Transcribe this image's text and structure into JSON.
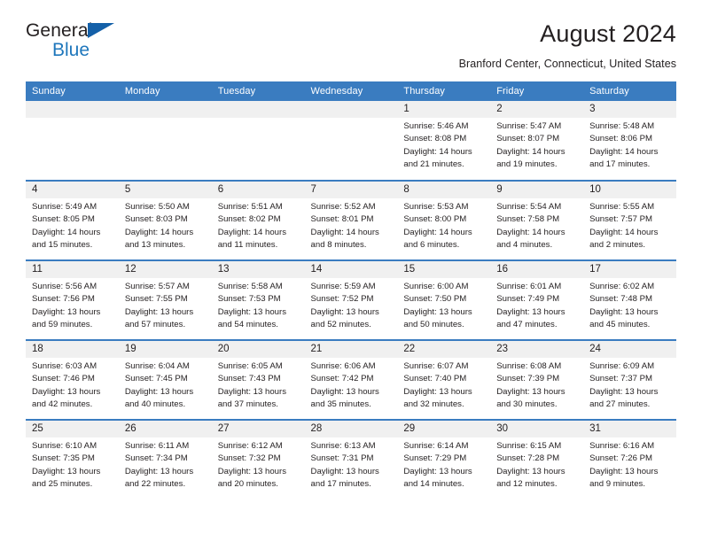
{
  "brand": {
    "name_part1": "General",
    "name_part2": "Blue",
    "flag_icon": "triangle-flag-icon",
    "accent_color": "#1f77bc"
  },
  "header": {
    "month_title": "August 2024",
    "location": "Branford Center, Connecticut, United States"
  },
  "theme": {
    "header_row_bg": "#3a7cc0",
    "daynum_bg": "#f0f0f0",
    "row_separator": "#3a7cc0"
  },
  "weekday_headers": [
    "Sunday",
    "Monday",
    "Tuesday",
    "Wednesday",
    "Thursday",
    "Friday",
    "Saturday"
  ],
  "weeks": [
    [
      {
        "day": "",
        "empty": true,
        "sunrise": "",
        "sunset": "",
        "daylight_line1": "",
        "daylight_line2": ""
      },
      {
        "day": "",
        "empty": true,
        "sunrise": "",
        "sunset": "",
        "daylight_line1": "",
        "daylight_line2": ""
      },
      {
        "day": "",
        "empty": true,
        "sunrise": "",
        "sunset": "",
        "daylight_line1": "",
        "daylight_line2": ""
      },
      {
        "day": "",
        "empty": true,
        "sunrise": "",
        "sunset": "",
        "daylight_line1": "",
        "daylight_line2": ""
      },
      {
        "day": "1",
        "sunrise": "Sunrise: 5:46 AM",
        "sunset": "Sunset: 8:08 PM",
        "daylight_line1": "Daylight: 14 hours",
        "daylight_line2": "and 21 minutes."
      },
      {
        "day": "2",
        "sunrise": "Sunrise: 5:47 AM",
        "sunset": "Sunset: 8:07 PM",
        "daylight_line1": "Daylight: 14 hours",
        "daylight_line2": "and 19 minutes."
      },
      {
        "day": "3",
        "sunrise": "Sunrise: 5:48 AM",
        "sunset": "Sunset: 8:06 PM",
        "daylight_line1": "Daylight: 14 hours",
        "daylight_line2": "and 17 minutes."
      }
    ],
    [
      {
        "day": "4",
        "sunrise": "Sunrise: 5:49 AM",
        "sunset": "Sunset: 8:05 PM",
        "daylight_line1": "Daylight: 14 hours",
        "daylight_line2": "and 15 minutes."
      },
      {
        "day": "5",
        "sunrise": "Sunrise: 5:50 AM",
        "sunset": "Sunset: 8:03 PM",
        "daylight_line1": "Daylight: 14 hours",
        "daylight_line2": "and 13 minutes."
      },
      {
        "day": "6",
        "sunrise": "Sunrise: 5:51 AM",
        "sunset": "Sunset: 8:02 PM",
        "daylight_line1": "Daylight: 14 hours",
        "daylight_line2": "and 11 minutes."
      },
      {
        "day": "7",
        "sunrise": "Sunrise: 5:52 AM",
        "sunset": "Sunset: 8:01 PM",
        "daylight_line1": "Daylight: 14 hours",
        "daylight_line2": "and 8 minutes."
      },
      {
        "day": "8",
        "sunrise": "Sunrise: 5:53 AM",
        "sunset": "Sunset: 8:00 PM",
        "daylight_line1": "Daylight: 14 hours",
        "daylight_line2": "and 6 minutes."
      },
      {
        "day": "9",
        "sunrise": "Sunrise: 5:54 AM",
        "sunset": "Sunset: 7:58 PM",
        "daylight_line1": "Daylight: 14 hours",
        "daylight_line2": "and 4 minutes."
      },
      {
        "day": "10",
        "sunrise": "Sunrise: 5:55 AM",
        "sunset": "Sunset: 7:57 PM",
        "daylight_line1": "Daylight: 14 hours",
        "daylight_line2": "and 2 minutes."
      }
    ],
    [
      {
        "day": "11",
        "sunrise": "Sunrise: 5:56 AM",
        "sunset": "Sunset: 7:56 PM",
        "daylight_line1": "Daylight: 13 hours",
        "daylight_line2": "and 59 minutes."
      },
      {
        "day": "12",
        "sunrise": "Sunrise: 5:57 AM",
        "sunset": "Sunset: 7:55 PM",
        "daylight_line1": "Daylight: 13 hours",
        "daylight_line2": "and 57 minutes."
      },
      {
        "day": "13",
        "sunrise": "Sunrise: 5:58 AM",
        "sunset": "Sunset: 7:53 PM",
        "daylight_line1": "Daylight: 13 hours",
        "daylight_line2": "and 54 minutes."
      },
      {
        "day": "14",
        "sunrise": "Sunrise: 5:59 AM",
        "sunset": "Sunset: 7:52 PM",
        "daylight_line1": "Daylight: 13 hours",
        "daylight_line2": "and 52 minutes."
      },
      {
        "day": "15",
        "sunrise": "Sunrise: 6:00 AM",
        "sunset": "Sunset: 7:50 PM",
        "daylight_line1": "Daylight: 13 hours",
        "daylight_line2": "and 50 minutes."
      },
      {
        "day": "16",
        "sunrise": "Sunrise: 6:01 AM",
        "sunset": "Sunset: 7:49 PM",
        "daylight_line1": "Daylight: 13 hours",
        "daylight_line2": "and 47 minutes."
      },
      {
        "day": "17",
        "sunrise": "Sunrise: 6:02 AM",
        "sunset": "Sunset: 7:48 PM",
        "daylight_line1": "Daylight: 13 hours",
        "daylight_line2": "and 45 minutes."
      }
    ],
    [
      {
        "day": "18",
        "sunrise": "Sunrise: 6:03 AM",
        "sunset": "Sunset: 7:46 PM",
        "daylight_line1": "Daylight: 13 hours",
        "daylight_line2": "and 42 minutes."
      },
      {
        "day": "19",
        "sunrise": "Sunrise: 6:04 AM",
        "sunset": "Sunset: 7:45 PM",
        "daylight_line1": "Daylight: 13 hours",
        "daylight_line2": "and 40 minutes."
      },
      {
        "day": "20",
        "sunrise": "Sunrise: 6:05 AM",
        "sunset": "Sunset: 7:43 PM",
        "daylight_line1": "Daylight: 13 hours",
        "daylight_line2": "and 37 minutes."
      },
      {
        "day": "21",
        "sunrise": "Sunrise: 6:06 AM",
        "sunset": "Sunset: 7:42 PM",
        "daylight_line1": "Daylight: 13 hours",
        "daylight_line2": "and 35 minutes."
      },
      {
        "day": "22",
        "sunrise": "Sunrise: 6:07 AM",
        "sunset": "Sunset: 7:40 PM",
        "daylight_line1": "Daylight: 13 hours",
        "daylight_line2": "and 32 minutes."
      },
      {
        "day": "23",
        "sunrise": "Sunrise: 6:08 AM",
        "sunset": "Sunset: 7:39 PM",
        "daylight_line1": "Daylight: 13 hours",
        "daylight_line2": "and 30 minutes."
      },
      {
        "day": "24",
        "sunrise": "Sunrise: 6:09 AM",
        "sunset": "Sunset: 7:37 PM",
        "daylight_line1": "Daylight: 13 hours",
        "daylight_line2": "and 27 minutes."
      }
    ],
    [
      {
        "day": "25",
        "sunrise": "Sunrise: 6:10 AM",
        "sunset": "Sunset: 7:35 PM",
        "daylight_line1": "Daylight: 13 hours",
        "daylight_line2": "and 25 minutes."
      },
      {
        "day": "26",
        "sunrise": "Sunrise: 6:11 AM",
        "sunset": "Sunset: 7:34 PM",
        "daylight_line1": "Daylight: 13 hours",
        "daylight_line2": "and 22 minutes."
      },
      {
        "day": "27",
        "sunrise": "Sunrise: 6:12 AM",
        "sunset": "Sunset: 7:32 PM",
        "daylight_line1": "Daylight: 13 hours",
        "daylight_line2": "and 20 minutes."
      },
      {
        "day": "28",
        "sunrise": "Sunrise: 6:13 AM",
        "sunset": "Sunset: 7:31 PM",
        "daylight_line1": "Daylight: 13 hours",
        "daylight_line2": "and 17 minutes."
      },
      {
        "day": "29",
        "sunrise": "Sunrise: 6:14 AM",
        "sunset": "Sunset: 7:29 PM",
        "daylight_line1": "Daylight: 13 hours",
        "daylight_line2": "and 14 minutes."
      },
      {
        "day": "30",
        "sunrise": "Sunrise: 6:15 AM",
        "sunset": "Sunset: 7:28 PM",
        "daylight_line1": "Daylight: 13 hours",
        "daylight_line2": "and 12 minutes."
      },
      {
        "day": "31",
        "sunrise": "Sunrise: 6:16 AM",
        "sunset": "Sunset: 7:26 PM",
        "daylight_line1": "Daylight: 13 hours",
        "daylight_line2": "and 9 minutes."
      }
    ]
  ]
}
